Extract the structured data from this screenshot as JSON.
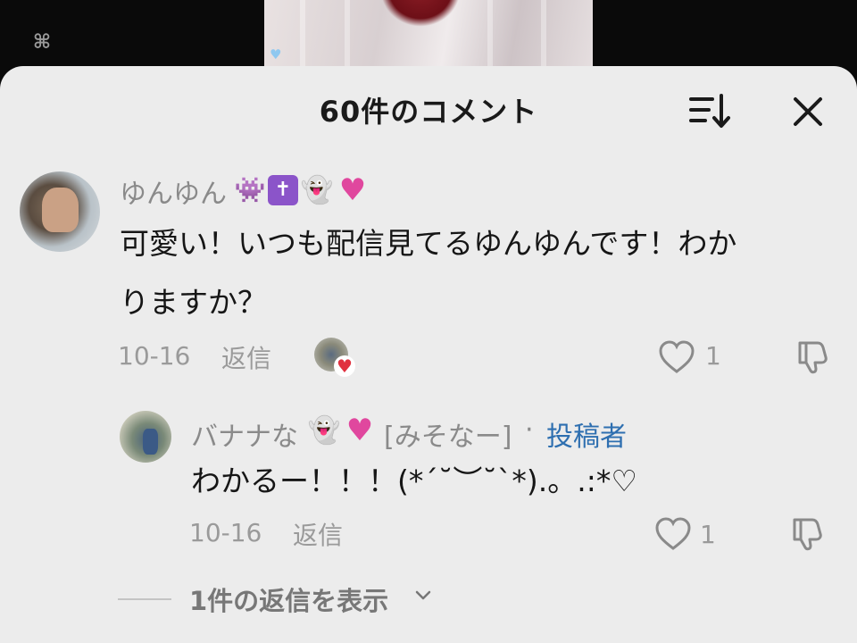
{
  "header": {
    "title": "60件のコメント"
  },
  "comments": [
    {
      "username": "ゆんゆん",
      "text_line1": "可愛い！いつも配信見てるゆんゆんです！わか",
      "text_line2": "りますか？",
      "date": "10-16",
      "reply_label": "返信",
      "like_count": "1",
      "emojis": [
        "alien-monster",
        "latin-cross",
        "ghost",
        "pink-heart"
      ]
    }
  ],
  "reply": {
    "username": "バナナな",
    "tag": "[みそなー]",
    "separator": "·",
    "author_badge": "投稿者",
    "text": "わかるー！！！(*ˊ˘︶˘ˋ*).。.:*♡",
    "date": "10-16",
    "reply_label": "返信",
    "like_count": "1",
    "emojis": [
      "ghost",
      "pink-heart"
    ]
  },
  "view_replies": {
    "label": "1件の返信を表示"
  },
  "colors": {
    "sheet_bg": "#ececec",
    "author_badge": "#2e6fb0",
    "heart_red": "#e0313f"
  }
}
